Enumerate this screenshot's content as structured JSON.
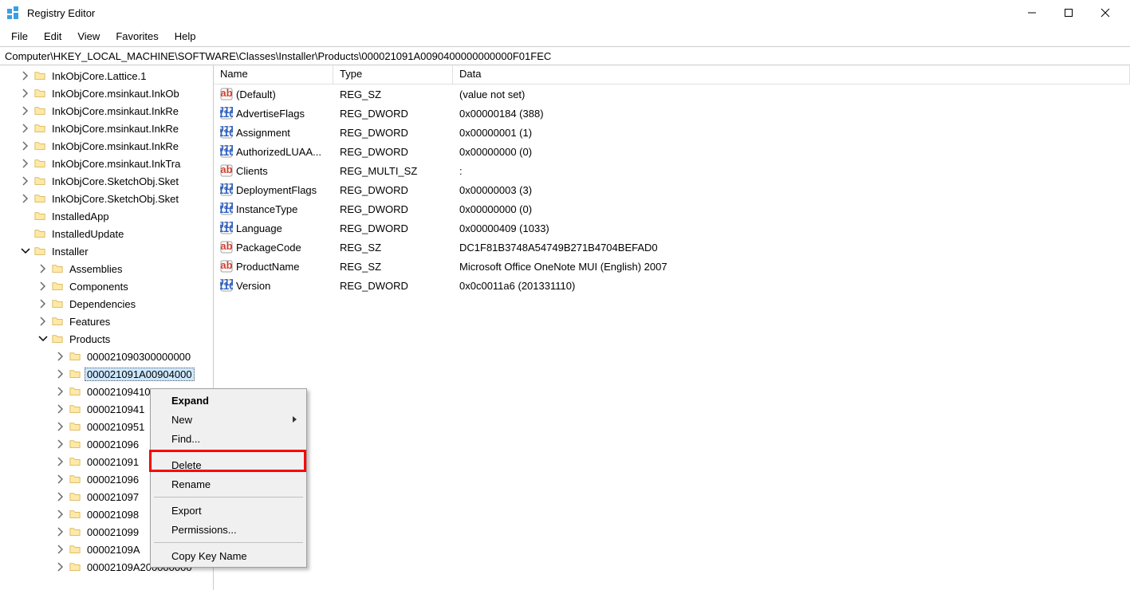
{
  "window": {
    "title": "Registry Editor"
  },
  "menubar": {
    "items": [
      "File",
      "Edit",
      "View",
      "Favorites",
      "Help"
    ]
  },
  "addressbar": {
    "path": "Computer\\HKEY_LOCAL_MACHINE\\SOFTWARE\\Classes\\Installer\\Products\\000021091A0090400000000000F01FEC"
  },
  "tree": {
    "items": [
      {
        "label": "InkObjCore.Lattice.1",
        "indent": 1,
        "expander": "closed"
      },
      {
        "label": "InkObjCore.msinkaut.InkOb",
        "indent": 1,
        "expander": "closed"
      },
      {
        "label": "InkObjCore.msinkaut.InkRe",
        "indent": 1,
        "expander": "closed"
      },
      {
        "label": "InkObjCore.msinkaut.InkRe",
        "indent": 1,
        "expander": "closed"
      },
      {
        "label": "InkObjCore.msinkaut.InkRe",
        "indent": 1,
        "expander": "closed"
      },
      {
        "label": "InkObjCore.msinkaut.InkTra",
        "indent": 1,
        "expander": "closed"
      },
      {
        "label": "InkObjCore.SketchObj.Sket",
        "indent": 1,
        "expander": "closed"
      },
      {
        "label": "InkObjCore.SketchObj.Sket",
        "indent": 1,
        "expander": "closed"
      },
      {
        "label": "InstalledApp",
        "indent": 1,
        "expander": "none"
      },
      {
        "label": "InstalledUpdate",
        "indent": 1,
        "expander": "none"
      },
      {
        "label": "Installer",
        "indent": 1,
        "expander": "open"
      },
      {
        "label": "Assemblies",
        "indent": 2,
        "expander": "closed"
      },
      {
        "label": "Components",
        "indent": 2,
        "expander": "closed"
      },
      {
        "label": "Dependencies",
        "indent": 2,
        "expander": "closed"
      },
      {
        "label": "Features",
        "indent": 2,
        "expander": "closed"
      },
      {
        "label": "Products",
        "indent": 2,
        "expander": "open"
      },
      {
        "label": "000021090300000000",
        "indent": 3,
        "expander": "closed"
      },
      {
        "label": "000021091A00904000",
        "indent": 3,
        "expander": "closed",
        "selected": true
      },
      {
        "label": "00002109410",
        "indent": 3,
        "expander": "closed"
      },
      {
        "label": "0000210941",
        "indent": 3,
        "expander": "closed"
      },
      {
        "label": "0000210951",
        "indent": 3,
        "expander": "closed"
      },
      {
        "label": "000021096",
        "indent": 3,
        "expander": "closed"
      },
      {
        "label": "000021091",
        "indent": 3,
        "expander": "closed"
      },
      {
        "label": "000021096",
        "indent": 3,
        "expander": "closed"
      },
      {
        "label": "000021097",
        "indent": 3,
        "expander": "closed"
      },
      {
        "label": "000021098",
        "indent": 3,
        "expander": "closed"
      },
      {
        "label": "000021099",
        "indent": 3,
        "expander": "closed"
      },
      {
        "label": "00002109A",
        "indent": 3,
        "expander": "closed"
      },
      {
        "label": "00002109A200000000",
        "indent": 3,
        "expander": "closed"
      }
    ]
  },
  "list": {
    "columns": {
      "name": "Name",
      "type": "Type",
      "data": "Data"
    },
    "rows": [
      {
        "name": "(Default)",
        "type": "REG_SZ",
        "data": "(value not set)",
        "icon": "sz"
      },
      {
        "name": "AdvertiseFlags",
        "type": "REG_DWORD",
        "data": "0x00000184 (388)",
        "icon": "bin"
      },
      {
        "name": "Assignment",
        "type": "REG_DWORD",
        "data": "0x00000001 (1)",
        "icon": "bin"
      },
      {
        "name": "AuthorizedLUAA...",
        "type": "REG_DWORD",
        "data": "0x00000000 (0)",
        "icon": "bin"
      },
      {
        "name": "Clients",
        "type": "REG_MULTI_SZ",
        "data": ":",
        "icon": "sz"
      },
      {
        "name": "DeploymentFlags",
        "type": "REG_DWORD",
        "data": "0x00000003 (3)",
        "icon": "bin"
      },
      {
        "name": "InstanceType",
        "type": "REG_DWORD",
        "data": "0x00000000 (0)",
        "icon": "bin"
      },
      {
        "name": "Language",
        "type": "REG_DWORD",
        "data": "0x00000409 (1033)",
        "icon": "bin"
      },
      {
        "name": "PackageCode",
        "type": "REG_SZ",
        "data": "DC1F81B3748A54749B271B4704BEFAD0",
        "icon": "sz"
      },
      {
        "name": "ProductName",
        "type": "REG_SZ",
        "data": "Microsoft Office OneNote MUI (English) 2007",
        "icon": "sz"
      },
      {
        "name": "Version",
        "type": "REG_DWORD",
        "data": "0x0c0011a6 (201331110)",
        "icon": "bin"
      }
    ]
  },
  "context_menu": {
    "items": [
      {
        "label": "Expand",
        "bold": true
      },
      {
        "label": "New",
        "submenu": true
      },
      {
        "label": "Find..."
      },
      {
        "sep": true
      },
      {
        "label": "Delete"
      },
      {
        "label": "Rename"
      },
      {
        "sep": true
      },
      {
        "label": "Export"
      },
      {
        "label": "Permissions..."
      },
      {
        "sep": true
      },
      {
        "label": "Copy Key Name"
      }
    ]
  }
}
